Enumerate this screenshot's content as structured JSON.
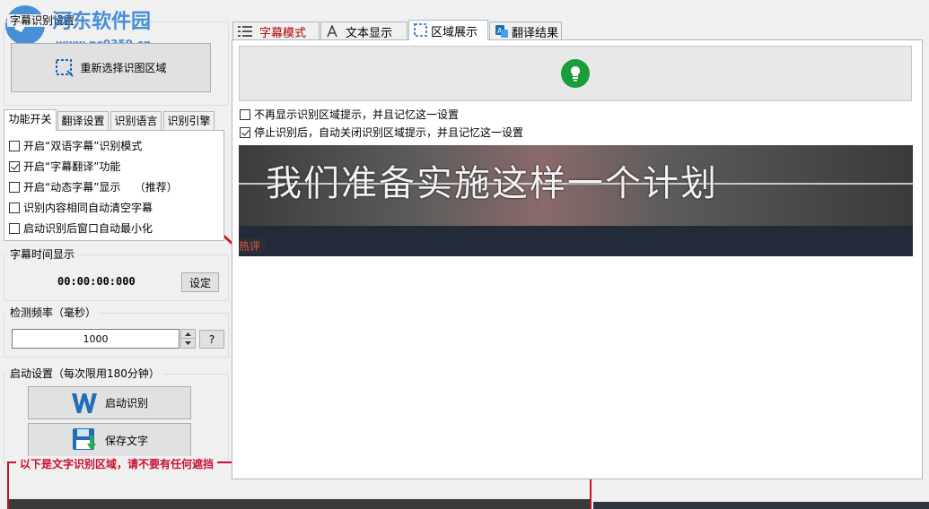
{
  "watermark": {
    "site_name": "河东软件园",
    "url": "www.pc0359.cn"
  },
  "region_group": {
    "title": "字幕识别设置",
    "reselect_label": "重新选择识图区域"
  },
  "left_tabs": [
    {
      "label": "功能开关",
      "active": true
    },
    {
      "label": "翻译设置",
      "active": false
    },
    {
      "label": "识别语言",
      "active": false
    },
    {
      "label": "识别引擎",
      "active": false
    }
  ],
  "feature_options": [
    {
      "label": "开启“双语字幕”识别模式",
      "checked": false
    },
    {
      "label": "开启“字幕翻译”功能",
      "checked": true
    },
    {
      "label": "开启“动态字幕”显示    （推荐）",
      "checked": false
    },
    {
      "label": "识别内容相同自动清空字幕",
      "checked": false
    },
    {
      "label": "启动识别后窗口自动最小化",
      "checked": false
    }
  ],
  "time_group": {
    "title": "字幕时间显示",
    "time": "00:00:00:000",
    "set_label": "设定"
  },
  "freq_group": {
    "title": "检测频率（毫秒）",
    "value": "1000",
    "help_label": "?"
  },
  "start_group": {
    "title": "启动设置（每次限用180分钟）",
    "start_label": "启动识别",
    "save_label": "保存文字"
  },
  "bottom_region": {
    "label": "以下是文字识别区域，请不要有任何遮挡",
    "color": "#c8102e"
  },
  "right_tabs": [
    {
      "label": "字幕模式",
      "icon": "list-icon",
      "active": false,
      "color": "#b00000"
    },
    {
      "label": "文本显示",
      "icon": "text-a-icon",
      "active": false,
      "color": "#000000"
    },
    {
      "label": "区域展示",
      "icon": "region-select-icon",
      "active": true,
      "color": "#000000"
    },
    {
      "label": "翻译结果",
      "icon": "translate-icon",
      "active": false,
      "color": "#000000"
    }
  ],
  "region_panel": {
    "options": [
      {
        "label": "不再显示识别区域提示，并且记忆这一设置",
        "checked": false
      },
      {
        "label": "停止识别后，自动关闭识别区域提示，并且记忆这一设置",
        "checked": true
      }
    ],
    "preview_subtitle": "我们准备实施这样一个计划",
    "preview_tag": "热评",
    "bulb_color": "#1a9e3a"
  }
}
